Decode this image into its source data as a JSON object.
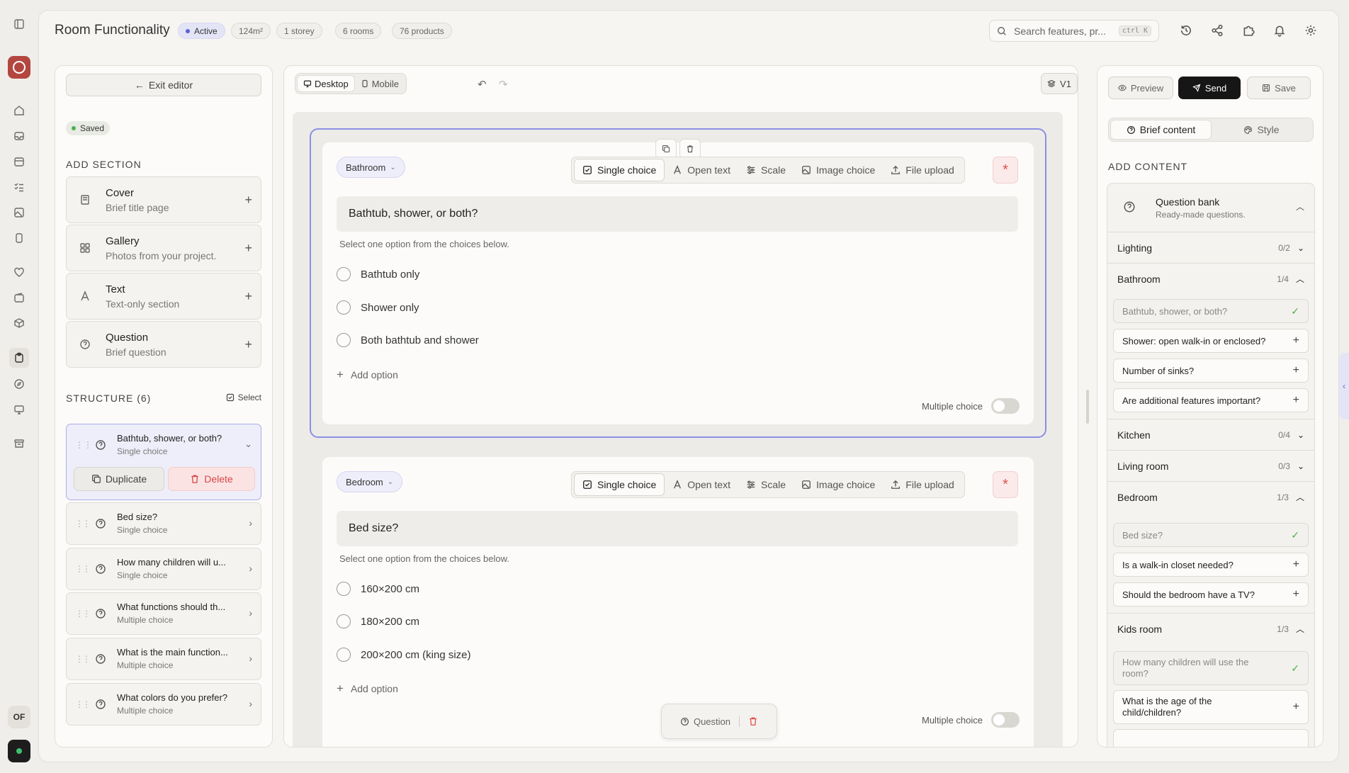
{
  "app": {
    "title": "Room Functionality",
    "status": "Active",
    "meta": [
      "124m²",
      "1 storey",
      "6 rooms",
      "76 products"
    ],
    "search_placeholder": "Search features, pr...",
    "search_shortcut": "ctrl K",
    "user_initials": "OF"
  },
  "left": {
    "exit_label": "Exit editor",
    "saved_label": "Saved",
    "add_section_heading": "ADD SECTION",
    "sections": [
      {
        "title": "Cover",
        "subtitle": "Brief title page",
        "icon": "cover-icon"
      },
      {
        "title": "Gallery",
        "subtitle": "Photos from your project.",
        "icon": "gallery-icon"
      },
      {
        "title": "Text",
        "subtitle": "Text-only section",
        "icon": "text-icon"
      },
      {
        "title": "Question",
        "subtitle": "Brief question",
        "icon": "question-icon"
      }
    ],
    "structure_heading": "STRUCTURE (6)",
    "select_label": "Select",
    "structure": [
      {
        "title": "Bathtub, shower, or both?",
        "type": "Single choice"
      },
      {
        "title": "Bed size?",
        "type": "Single choice"
      },
      {
        "title": "How many children will u...",
        "type": "Single choice"
      },
      {
        "title": "What functions should th...",
        "type": "Multiple choice"
      },
      {
        "title": "What is the main function...",
        "type": "Multiple choice"
      },
      {
        "title": "What colors do you prefer?",
        "type": "Multiple choice"
      }
    ],
    "duplicate_label": "Duplicate",
    "delete_label": "Delete"
  },
  "center": {
    "view_desktop": "Desktop",
    "view_mobile": "Mobile",
    "version": "V1",
    "question_types": [
      "Single choice",
      "Open text",
      "Scale",
      "Image choice",
      "File upload"
    ],
    "required_symbol": "*",
    "add_option_label": "Add option",
    "multiple_choice_label": "Multiple choice",
    "cards": [
      {
        "room": "Bathroom",
        "question": "Bathtub, shower, or both?",
        "hint": "Select one option from the choices below.",
        "options": [
          "Bathtub only",
          "Shower only",
          "Both bathtub and shower"
        ]
      },
      {
        "room": "Bedroom",
        "question": "Bed size?",
        "hint": "Select one option from the choices below.",
        "options": [
          "160×200 cm",
          "180×200 cm",
          "200×200 cm (king size)"
        ]
      }
    ],
    "floating_label": "Question"
  },
  "right": {
    "preview_label": "Preview",
    "send_label": "Send",
    "save_label": "Save",
    "tab_brief": "Brief content",
    "tab_style": "Style",
    "add_content_heading": "ADD CONTENT",
    "bank_title": "Question bank",
    "bank_subtitle": "Ready-made questions.",
    "categories": [
      {
        "name": "Lighting",
        "count": "0/2"
      },
      {
        "name": "Bathroom",
        "count": "1/4"
      },
      {
        "name": "Kitchen",
        "count": "0/4"
      },
      {
        "name": "Living room",
        "count": "0/3"
      },
      {
        "name": "Bedroom",
        "count": "1/3"
      },
      {
        "name": "Kids room",
        "count": "1/3"
      }
    ],
    "bathroom_questions": [
      "Bathtub, shower, or both?",
      "Shower: open walk-in or enclosed?",
      "Number of sinks?",
      "Are additional features important?"
    ],
    "bedroom_questions": [
      "Bed size?",
      "Is a walk-in closet needed?",
      "Should the bedroom have a TV?"
    ],
    "kids_questions": [
      "How many children will use the room?",
      "What is the age of the child/children?"
    ]
  },
  "colors": {
    "accent": "#5b61d6",
    "brand": "#b3473f",
    "danger": "#e05050",
    "success": "#4caf50"
  }
}
